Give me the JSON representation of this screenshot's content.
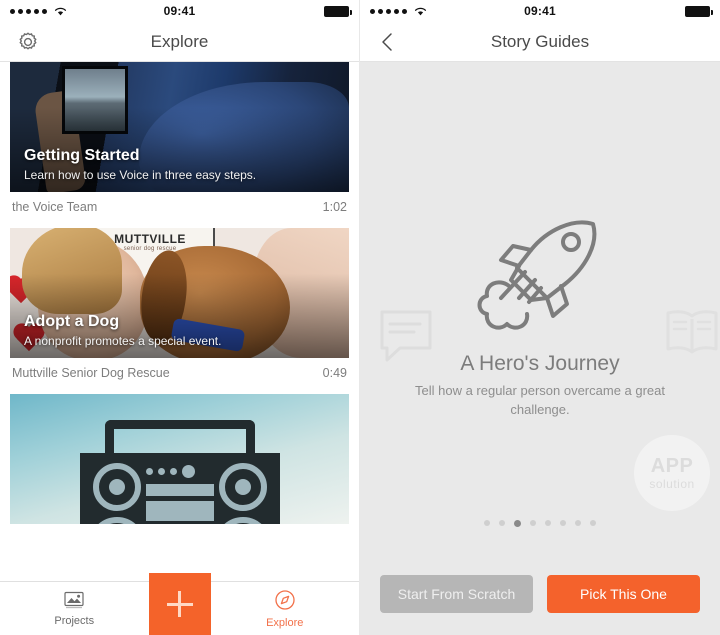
{
  "status_bar": {
    "time": "09:41",
    "signal_icon": "signal-dots-icon",
    "wifi_icon": "wifi-icon",
    "battery_icon": "battery-full-icon"
  },
  "explore_screen": {
    "nav": {
      "title": "Explore",
      "left_icon": "gear-icon"
    },
    "cards": [
      {
        "title": "Getting Started",
        "subtitle": "Learn how to use Voice in three easy steps.",
        "author": "the Voice Team",
        "duration": "1:02",
        "image": "person-holding-phone-photo"
      },
      {
        "title": "Adopt a Dog",
        "subtitle": "A nonprofit promotes a special event.",
        "author": "Muttville Senior Dog Rescue",
        "duration": "0:49",
        "image": "woman-with-dog-muttville-photo",
        "poster_title": "MUTTVILLE",
        "poster_subtitle": "senior dog rescue"
      },
      {
        "title": "",
        "subtitle": "",
        "author": "",
        "duration": "",
        "image": "boombox-illustration-photo"
      }
    ],
    "tabbar": {
      "projects": {
        "label": "Projects",
        "icon": "photo-stack-icon"
      },
      "add": {
        "label": "",
        "icon": "plus-icon",
        "color": "#f4632a"
      },
      "explore": {
        "label": "Explore",
        "icon": "compass-icon",
        "color": "#f2714a"
      }
    }
  },
  "story_guides_screen": {
    "nav": {
      "title": "Story Guides",
      "left_icon": "chevron-left-icon"
    },
    "ghost_left_icon": "speech-bubble-icon",
    "ghost_right_icon": "open-book-icon",
    "hero_icon": "rocket-icon",
    "title": "A Hero's Journey",
    "description": "Tell how a regular person overcame a great challenge.",
    "pager": {
      "count": 8,
      "active_index": 2
    },
    "watermark": {
      "line1": "APP",
      "line2": "solution"
    },
    "actions": {
      "secondary": {
        "label": "Start From Scratch",
        "color": "#b6b6b6"
      },
      "primary": {
        "label": "Pick This One",
        "color": "#f4622c"
      }
    }
  }
}
